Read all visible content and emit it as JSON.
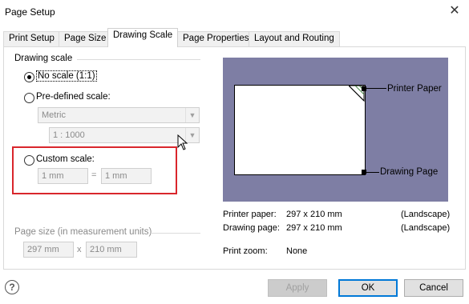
{
  "window": {
    "title": "Page Setup",
    "close_glyph": "✕"
  },
  "tabs": [
    {
      "label": "Print Setup"
    },
    {
      "label": "Page Size"
    },
    {
      "label": "Drawing Scale",
      "active": true
    },
    {
      "label": "Page Properties"
    },
    {
      "label": "Layout and Routing"
    }
  ],
  "drawing_scale": {
    "group_label": "Drawing scale",
    "no_scale_label": "No scale (1:1)",
    "no_scale_selected": true,
    "predefined_label": "Pre-defined scale:",
    "predefined_selected": false,
    "predefined_category": "Metric",
    "predefined_value": "1 : 1000",
    "custom_label": "Custom scale:",
    "custom_selected": false,
    "custom_left": "1 mm",
    "custom_equals": "=",
    "custom_right": "1 mm"
  },
  "page_size": {
    "group_label": "Page size (in measurement units)",
    "width": "297 mm",
    "separator": "x",
    "height": "210 mm"
  },
  "preview": {
    "printer_paper_label": "Printer Paper",
    "drawing_page_label": "Drawing Page",
    "background_color": "#7e7ea4"
  },
  "info": {
    "printer_paper_key": "Printer paper:",
    "printer_paper_value": "297 x 210 mm",
    "printer_paper_orientation": "(Landscape)",
    "drawing_page_key": "Drawing page:",
    "drawing_page_value": "297 x 210 mm",
    "drawing_page_orientation": "(Landscape)",
    "print_zoom_key": "Print zoom:",
    "print_zoom_value": "None"
  },
  "buttons": {
    "help_glyph": "?",
    "apply": "Apply",
    "ok": "OK",
    "cancel": "Cancel"
  },
  "colors": {
    "highlight": "#d9262c",
    "default_button_border": "#0078d7"
  }
}
